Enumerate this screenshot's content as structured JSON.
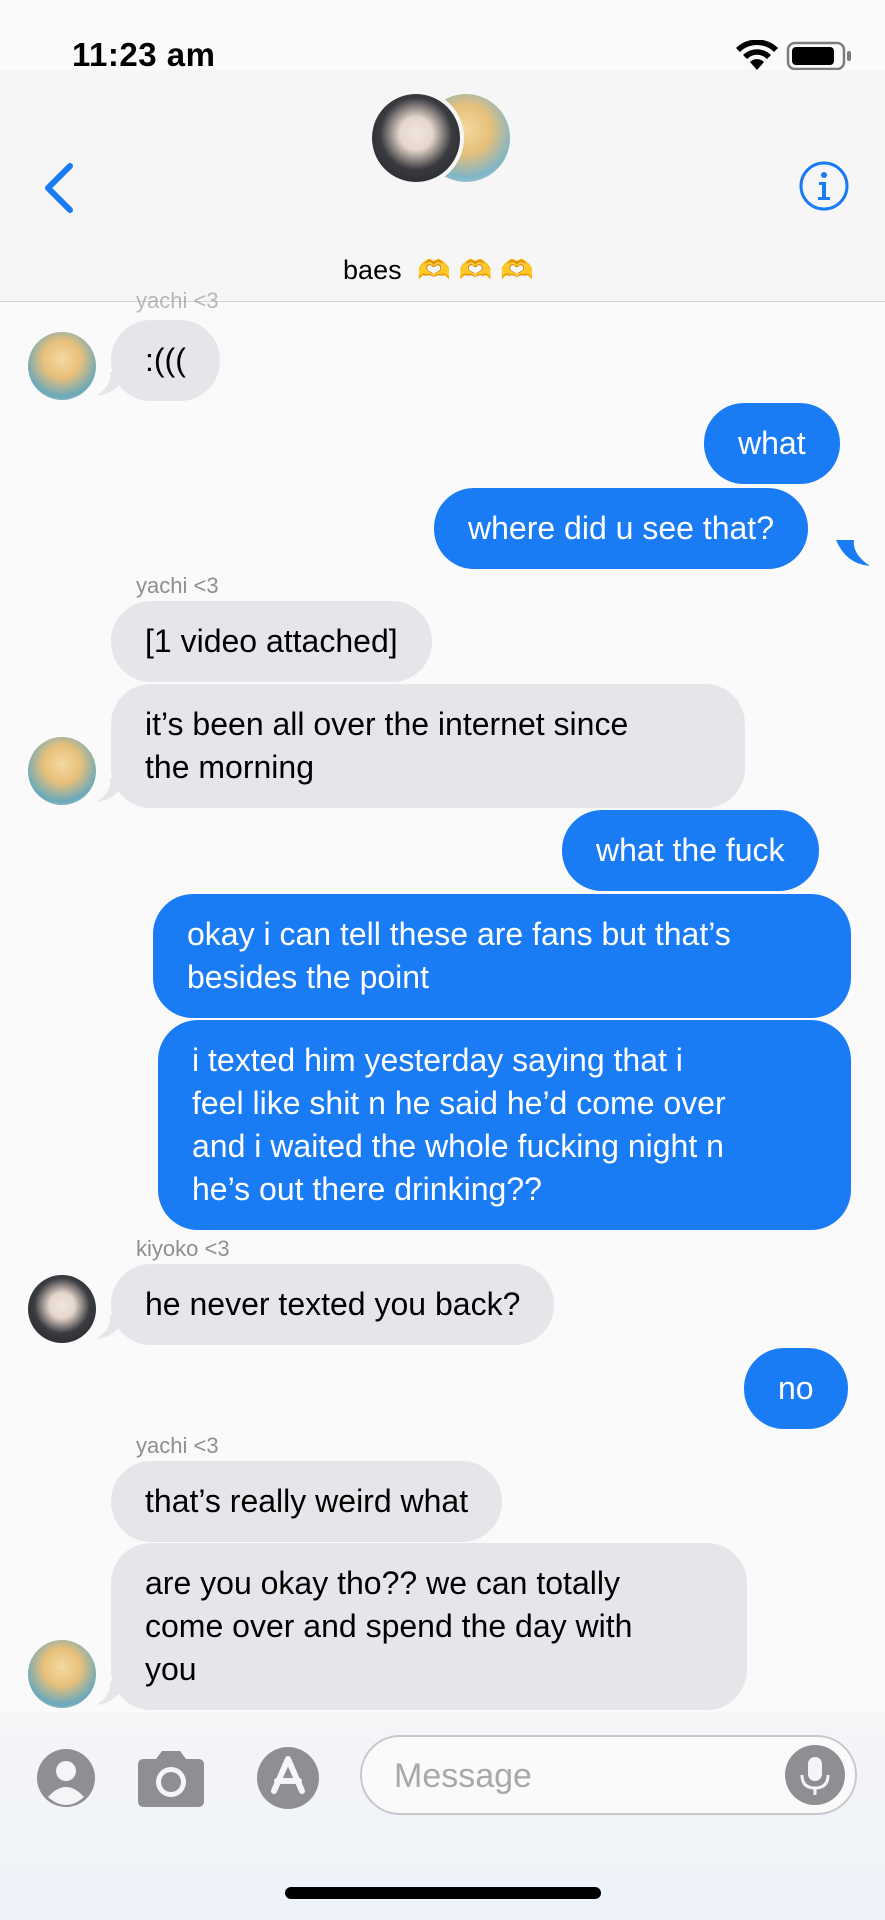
{
  "status_bar": {
    "time": "11:23 am"
  },
  "header": {
    "group_name": "baes",
    "group_emoji": "🫶🫶🫶",
    "back_icon": "chevron-left-icon",
    "info_icon": "info-circle-icon"
  },
  "messages": [
    {
      "sender": "yachi <3",
      "text": ":((("
    },
    {
      "sender": "me",
      "text": "what"
    },
    {
      "sender": "me",
      "text": "where did u see that?"
    },
    {
      "sender": "yachi <3",
      "text": "[1 video attached]"
    },
    {
      "sender": "yachi <3",
      "text": "it’s been all over the internet since\nthe morning"
    },
    {
      "sender": "me",
      "text": "what the fuck"
    },
    {
      "sender": "me",
      "text": "okay i can tell these are fans but that’s\nbesides the point"
    },
    {
      "sender": "me",
      "text": "i texted him yesterday saying that i\nfeel like shit n he said he’d come over\nand i waited the whole fucking night n\nhe’s out there drinking??"
    },
    {
      "sender": "kiyoko <3",
      "text": "he never texted you back?"
    },
    {
      "sender": "me",
      "text": "no"
    },
    {
      "sender": "yachi <3",
      "text": "that’s really weird what"
    },
    {
      "sender": "yachi <3",
      "text": "are you okay tho?? we can totally\ncome over and spend the day with\nyou"
    }
  ],
  "input_bar": {
    "placeholder": "Message",
    "contact_icon": "person-circle-icon",
    "camera_icon": "camera-icon",
    "appstore_icon": "app-store-icon",
    "mic_icon": "microphone-icon"
  },
  "colors": {
    "outgoing": "#1a7cf5",
    "incoming": "#e6e5ea",
    "accent": "#1a7cf5"
  }
}
